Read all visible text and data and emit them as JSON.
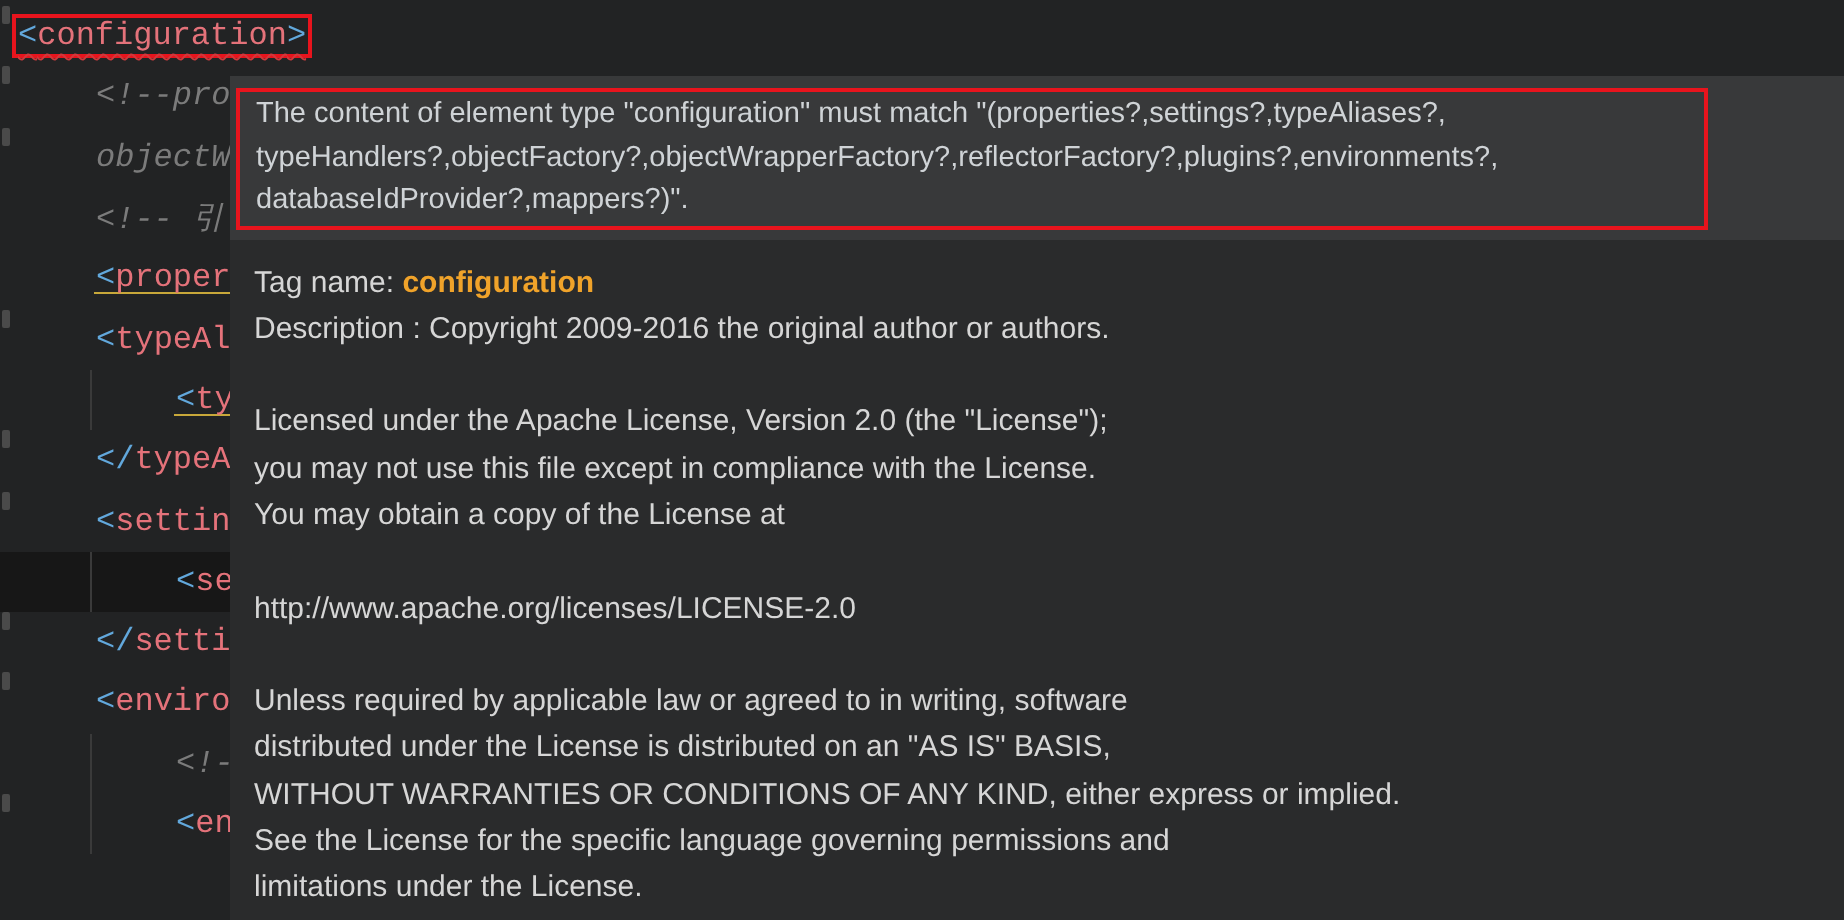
{
  "editor": {
    "lines": [
      {
        "kind": "tag",
        "text": "<configuration>",
        "error": true,
        "warning": false,
        "fold_marker": true,
        "current": false,
        "outlined": true,
        "children": [
          {
            "kind": "comment",
            "text": "<!--pro",
            "error": false,
            "warning": false,
            "fold_marker": true,
            "current": false,
            "outlined": false
          },
          {
            "kind": "comment",
            "text": "objectW",
            "error": false,
            "warning": false,
            "fold_marker": true,
            "current": false,
            "outlined": false
          },
          {
            "kind": "comment",
            "text": "<!-- 引",
            "error": false,
            "warning": false,
            "fold_marker": false,
            "current": false,
            "outlined": false
          },
          {
            "kind": "tag",
            "text": "<proper",
            "error": false,
            "warning": true,
            "fold_marker": false,
            "current": false,
            "outlined": false
          },
          {
            "kind": "tag",
            "text": "<typeAl",
            "error": false,
            "warning": false,
            "fold_marker": true,
            "current": false,
            "outlined": false,
            "children": [
              {
                "kind": "tag",
                "text": "<ty",
                "error": false,
                "warning": true,
                "fold_marker": false,
                "current": false,
                "outlined": false
              }
            ]
          },
          {
            "kind": "tag",
            "text": "</typeA",
            "error": false,
            "warning": false,
            "fold_marker": true,
            "current": false,
            "outlined": false
          },
          {
            "kind": "tag",
            "text": "<settin",
            "error": false,
            "warning": false,
            "fold_marker": true,
            "current": false,
            "outlined": false,
            "children": [
              {
                "kind": "tag",
                "text": "<se",
                "error": false,
                "warning": false,
                "fold_marker": false,
                "current": true,
                "outlined": false
              }
            ]
          },
          {
            "kind": "tag",
            "text": "</setti",
            "error": false,
            "warning": false,
            "fold_marker": true,
            "current": false,
            "outlined": false
          },
          {
            "kind": "tag",
            "text": "<enviro",
            "error": false,
            "warning": false,
            "fold_marker": true,
            "current": false,
            "outlined": false,
            "children": [
              {
                "kind": "comment",
                "text": "<!-",
                "error": false,
                "warning": false,
                "fold_marker": false,
                "current": false,
                "outlined": false
              },
              {
                "kind": "tag",
                "text": "<en",
                "error": false,
                "warning": false,
                "fold_marker": true,
                "current": false,
                "outlined": false
              }
            ]
          }
        ]
      }
    ]
  },
  "tooltip": {
    "error_message": [
      "The content of element type \"configuration\" must match \"(properties?,settings?,typeAliases?,",
      "typeHandlers?,objectFactory?,objectWrapperFactory?,reflectorFactory?,plugins?,environments?,",
      "databaseIdProvider?,mappers?)\"."
    ],
    "tag_label": "Tag name:",
    "tag_name": "configuration",
    "paragraphs": [
      [
        "Description : Copyright 2009-2016 the original author or authors."
      ],
      [
        "Licensed under the Apache License, Version 2.0 (the \"License\");",
        "you may not use this file except in compliance with the License.",
        "You may obtain a copy of the License at"
      ],
      [
        "http://www.apache.org/licenses/LICENSE-2.0"
      ],
      [
        "Unless required by applicable law or agreed to in writing, software",
        "distributed under the License is distributed on an \"AS IS\" BASIS,",
        "WITHOUT WARRANTIES OR CONDITIONS OF ANY KIND, either express or implied.",
        "See the License for the specific language governing permissions and",
        "limitations under the License."
      ]
    ]
  }
}
